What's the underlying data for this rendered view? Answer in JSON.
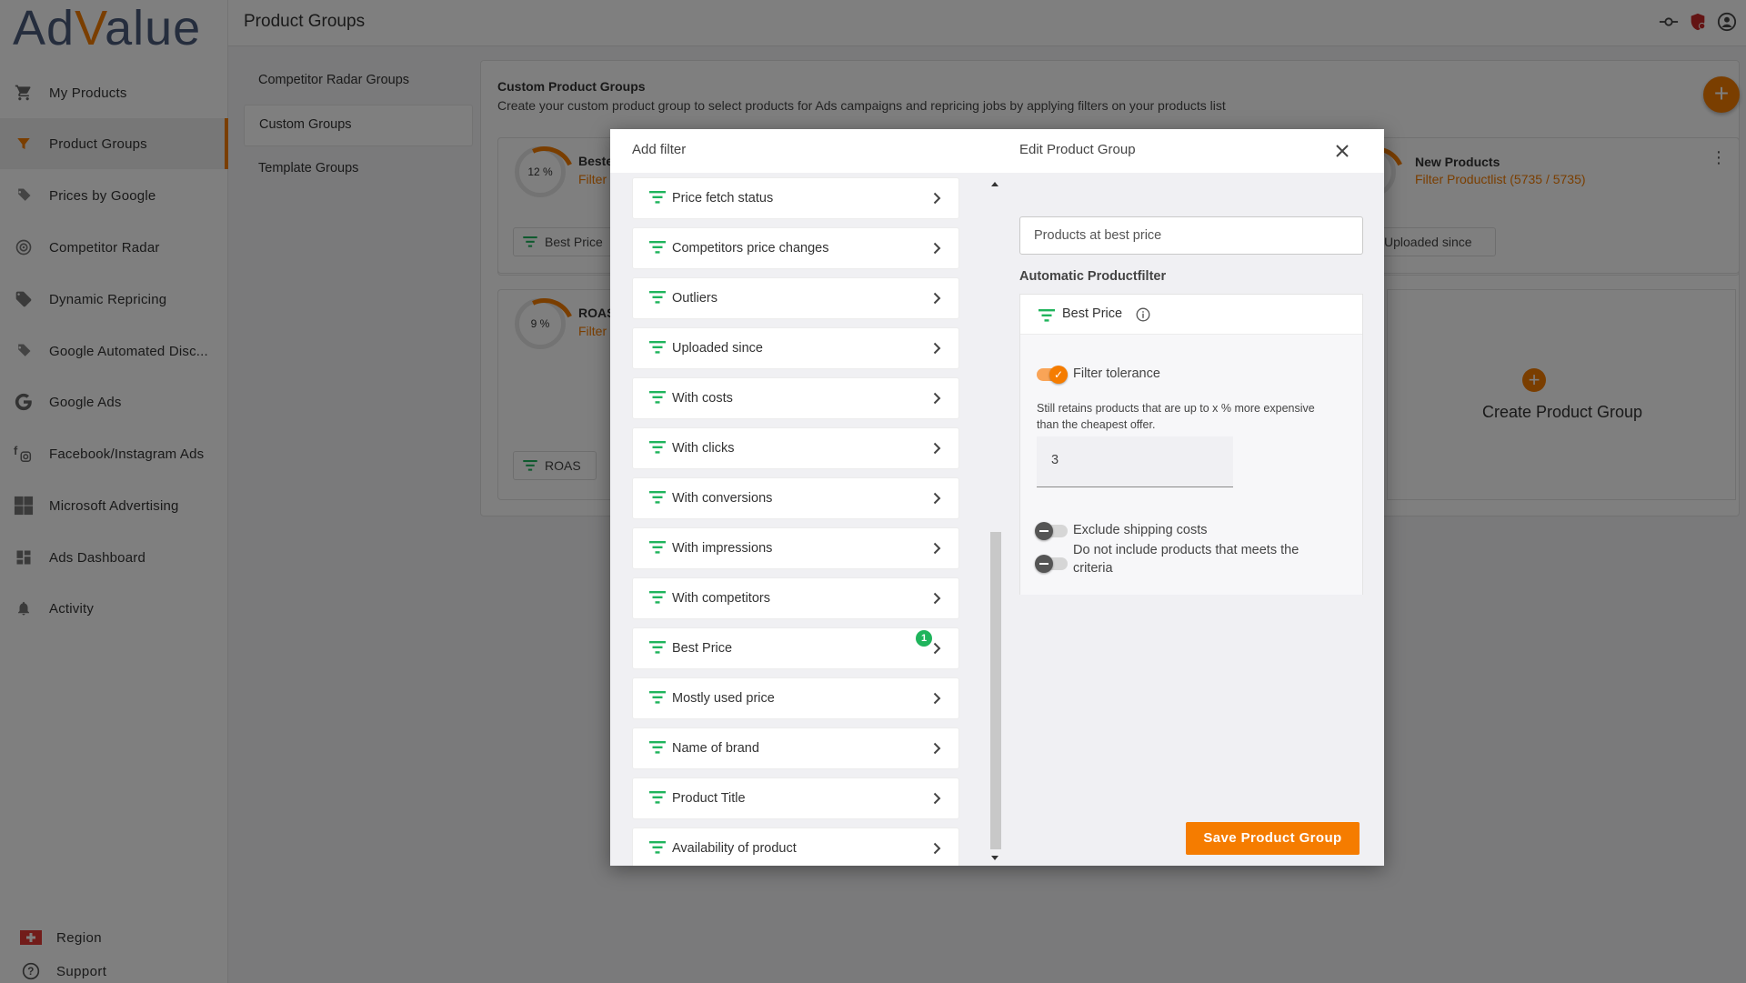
{
  "app": {
    "logo_text_a": "Ad",
    "logo_text_v": "V",
    "logo_text_rest": "alue"
  },
  "colors": {
    "accent": "#f57c00",
    "filter_icon": "#1fb45c",
    "badge": "#1fb45c"
  },
  "sidebar": {
    "items": [
      {
        "label": "My Products",
        "icon": "cart-icon"
      },
      {
        "label": "Product Groups",
        "icon": "funnel-icon",
        "active": true
      },
      {
        "label": "Prices by Google",
        "icon": "price-tags-icon"
      },
      {
        "label": "Competitor Radar",
        "icon": "radar-icon"
      },
      {
        "label": "Dynamic Repricing",
        "icon": "tag-icon"
      },
      {
        "label": "Google Automated Disc...",
        "icon": "discount-tags-icon"
      },
      {
        "label": "Google Ads",
        "icon": "google-icon"
      },
      {
        "label": "Facebook/Instagram Ads",
        "icon": "facebook-instagram-icon"
      },
      {
        "label": "Microsoft Advertising",
        "icon": "microsoft-icon"
      },
      {
        "label": "Ads Dashboard",
        "icon": "dashboard-icon"
      },
      {
        "label": "Activity",
        "icon": "bell-icon"
      }
    ],
    "region_label": "Region",
    "support_label": "Support"
  },
  "topbar": {
    "title": "Product Groups"
  },
  "subnav": {
    "items": [
      {
        "label": "Competitor Radar Groups"
      },
      {
        "label": "Custom Groups",
        "active": true
      },
      {
        "label": "Template Groups"
      }
    ]
  },
  "content": {
    "heading": "Custom Product Groups",
    "subheading": "Create your custom product group to select products for Ads campaigns and repricing jobs by applying filters on your products list",
    "cards": [
      {
        "percent": "12 %",
        "title": "Beste",
        "subtitle": "Filter",
        "chip": "Best Price"
      },
      {
        "percent": "9 %",
        "title": "ROAS",
        "subtitle": "Filter",
        "chip": "ROAS"
      },
      {
        "percent": "%",
        "title": "New Products",
        "subtitle": "Filter Productlist (5735 / 5735)",
        "chip": "Uploaded since"
      }
    ],
    "create_label": "Create Product Group"
  },
  "modal": {
    "add_filter_title": "Add filter",
    "edit_title": "Edit Product Group",
    "filters": [
      {
        "label": "Price fetch status"
      },
      {
        "label": "Competitors price changes"
      },
      {
        "label": "Outliers"
      },
      {
        "label": "Uploaded since"
      },
      {
        "label": "With costs"
      },
      {
        "label": "With clicks"
      },
      {
        "label": "With conversions"
      },
      {
        "label": "With impressions"
      },
      {
        "label": "With competitors"
      },
      {
        "label": "Best Price",
        "badge": "1"
      },
      {
        "label": "Mostly used price"
      },
      {
        "label": "Name of brand"
      },
      {
        "label": "Product Title"
      },
      {
        "label": "Availability of product"
      }
    ],
    "group_name_value": "Products at best price",
    "auto_filter_label": "Automatic Productfilter",
    "active_filter": {
      "title": "Best Price",
      "tolerance_label": "Filter tolerance",
      "tolerance_on": true,
      "description": "Still retains products that are up to x % more expensive than the cheapest offer.",
      "tolerance_value": "3",
      "exclude_shipping_label": "Exclude shipping costs",
      "exclude_shipping_on": false,
      "not_include_label": "Do not include products that meets the criteria",
      "not_include_on": false
    },
    "save_label": "Save Product Group"
  }
}
